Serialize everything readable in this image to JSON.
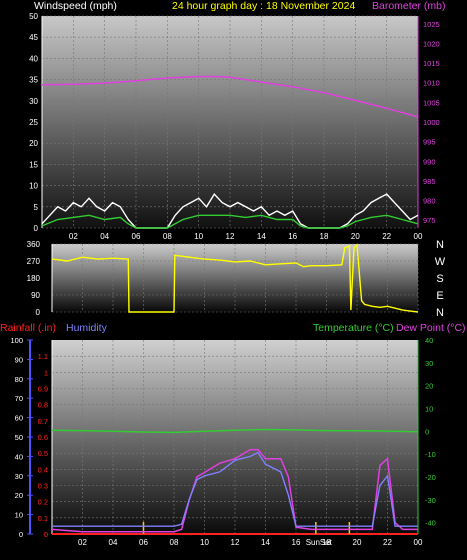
{
  "colors": {
    "background": "#000000",
    "windspeed": "#ffffff",
    "windspeed_avg": "#33cc33",
    "barometer": "#e040e0",
    "wind_dir": "#ffff00",
    "rainfall": "#ff2020",
    "humidity": "#8080ff",
    "temperature": "#33cc33",
    "dew_point": "#e040e0",
    "axis_left": "#5050ff",
    "axis_right_green": "#33cc33",
    "axis_right_barometer": "#e040e0",
    "marker": "#ffcc00"
  },
  "header": {
    "windspeed": "Windspeed (mph)",
    "title": "24 hour graph day : 18 November 2024",
    "barometer": "Barometer (mb)"
  },
  "bottom_header": {
    "rainfall": "Rainfall (.in)",
    "humidity": "Humidity",
    "temperature": "Temperature (°C)",
    "dew_point": "Dew Point (°C)"
  },
  "compass": [
    "N",
    "W",
    "S",
    "E",
    "N"
  ],
  "x_ticks": [
    "02",
    "04",
    "06",
    "08",
    "10",
    "12",
    "14",
    "16",
    "18",
    "20",
    "22",
    "00"
  ],
  "markers": [
    "Sun",
    "Set"
  ],
  "chart_data": [
    {
      "type": "line",
      "title": "24 hour graph day : 18 November 2024",
      "x_unit": "hour",
      "x_range": [
        0,
        24
      ],
      "y_left": {
        "label": "Windspeed (mph)",
        "ticks": [
          0,
          5,
          10,
          15,
          20,
          25,
          30,
          35,
          40,
          45,
          50
        ],
        "ylim": [
          0,
          50
        ]
      },
      "y_right": {
        "label": "Barometer (mb)",
        "ticks": [
          975,
          980,
          985,
          990,
          995,
          1000,
          1005,
          1010,
          1015,
          1020,
          1025
        ],
        "ylim": [
          973,
          1027
        ]
      },
      "series": [
        {
          "name": "Barometer (mb)",
          "axis": "right",
          "x": [
            0,
            2,
            4,
            6,
            8,
            10,
            11,
            12,
            14,
            16,
            18,
            20,
            22,
            24
          ],
          "values": [
            1009.5,
            1009.6,
            1009.9,
            1010.5,
            1011.2,
            1011.6,
            1011.6,
            1011.4,
            1010.2,
            1009.0,
            1007.5,
            1005.5,
            1003.5,
            1001.3
          ]
        },
        {
          "name": "Windspeed (mph)",
          "axis": "left",
          "x": [
            0,
            0.5,
            1,
            1.5,
            2,
            2.5,
            3,
            3.5,
            4,
            4.5,
            5,
            5.5,
            6,
            7,
            8,
            8.5,
            9,
            9.5,
            10,
            10.5,
            11,
            11.5,
            12,
            12.5,
            13,
            13.5,
            14,
            14.5,
            15,
            15.5,
            16,
            16.5,
            17,
            18,
            19,
            19.5,
            20,
            20.5,
            21,
            21.5,
            22,
            22.5,
            23,
            23.5,
            24
          ],
          "values": [
            1,
            3,
            5,
            4,
            6,
            5,
            7,
            5,
            4,
            6,
            5,
            2,
            0,
            0,
            0,
            3,
            5,
            6,
            7,
            5,
            8,
            6,
            5,
            6,
            5,
            4,
            5,
            3,
            4,
            3,
            4,
            1,
            0,
            0,
            0,
            1,
            3,
            4,
            6,
            7,
            8,
            6,
            4,
            2,
            3
          ]
        },
        {
          "name": "Wind average",
          "axis": "left",
          "x": [
            0,
            1,
            2,
            3,
            4,
            5,
            5.5,
            6,
            7,
            8,
            8.5,
            9,
            10,
            11,
            12,
            13,
            14,
            15,
            16,
            16.5,
            17,
            18,
            19,
            19.5,
            20,
            21,
            22,
            23,
            24
          ],
          "values": [
            0.5,
            2,
            2.5,
            3,
            2,
            2.5,
            1,
            0,
            0,
            0,
            1,
            2,
            3,
            3,
            3,
            2.5,
            3,
            2,
            2,
            0.5,
            0,
            0,
            0,
            0.5,
            1.5,
            2.5,
            3,
            2,
            1
          ]
        }
      ]
    },
    {
      "type": "line",
      "title": "",
      "x_unit": "hour",
      "x_range": [
        0,
        24
      ],
      "y_left": {
        "label": "",
        "ticks": [
          0,
          90,
          180,
          270,
          360
        ],
        "ylim": [
          0,
          360
        ]
      },
      "series": [
        {
          "name": "Wind direction",
          "x": [
            0,
            1,
            2,
            3,
            4,
            5,
            5.05,
            8,
            8.05,
            9,
            10,
            11,
            12,
            13,
            14,
            15,
            16,
            16.5,
            17,
            18,
            19,
            19.2,
            19.5,
            19.6,
            19.8,
            20,
            20.3,
            20.5,
            21,
            21.5,
            22,
            22.5,
            23,
            23.5,
            24
          ],
          "values": [
            280,
            270,
            290,
            280,
            285,
            280,
            0,
            0,
            300,
            290,
            280,
            275,
            265,
            270,
            250,
            255,
            260,
            240,
            245,
            245,
            250,
            340,
            350,
            10,
            340,
            355,
            60,
            40,
            30,
            25,
            30,
            20,
            10,
            5,
            0
          ]
        }
      ]
    },
    {
      "type": "line",
      "title": "",
      "x_unit": "hour",
      "x_range": [
        0,
        24
      ],
      "y_left": {
        "label": "Humidity",
        "ticks": [
          0,
          10,
          20,
          30,
          40,
          50,
          60,
          70,
          80,
          90,
          100
        ],
        "ylim": [
          0,
          100
        ]
      },
      "y_left_inner": {
        "label": "Rainfall (.in)",
        "ticks": [
          0,
          0.1,
          0.2,
          0.3,
          0.4,
          0.5,
          0.6,
          0.7,
          0.8,
          0.9,
          1,
          1.1
        ],
        "ylim": [
          0,
          1.2
        ]
      },
      "y_right": {
        "label": "Temperature (°C)",
        "ticks": [
          -40,
          -30,
          -20,
          -10,
          0,
          10,
          20,
          30,
          40
        ],
        "ylim": [
          -45,
          40
        ]
      },
      "series": [
        {
          "name": "Temperature (°C)",
          "axis": "right",
          "x": [
            0,
            2,
            4,
            6,
            8,
            10,
            12,
            14,
            16,
            18,
            20,
            22,
            24
          ],
          "values": [
            0.5,
            0.3,
            0.0,
            -0.3,
            -0.5,
            0.0,
            0.5,
            0.8,
            0.6,
            0.3,
            0.2,
            0.1,
            -0.2
          ]
        },
        {
          "name": "Dew Point (°C)",
          "axis": "right",
          "x": [
            0,
            2,
            4,
            6,
            8,
            8.5,
            9,
            9.5,
            10,
            11,
            12,
            13,
            13.5,
            14,
            15,
            15.5,
            16,
            17,
            18,
            19,
            20,
            21,
            21.5,
            22,
            22.5,
            23,
            24
          ],
          "values": [
            -43,
            -44,
            -44,
            -44,
            -44,
            -43,
            -30,
            -20,
            -18,
            -14,
            -12,
            -8,
            -8,
            -12,
            -12,
            -20,
            -42,
            -43,
            -43,
            -43,
            -43,
            -43,
            -15,
            -12,
            -40,
            -43,
            -43
          ]
        },
        {
          "name": "Humidity",
          "axis": "left",
          "x": [
            0,
            2,
            4,
            6,
            8,
            8.5,
            9,
            9.5,
            10,
            11,
            12,
            13,
            13.5,
            14,
            15,
            15.5,
            16,
            17,
            18,
            19,
            20,
            21,
            21.5,
            22,
            22.5,
            23,
            24
          ],
          "values": [
            4,
            4,
            4,
            4,
            4,
            5,
            18,
            28,
            30,
            32,
            38,
            40,
            42,
            36,
            32,
            20,
            4,
            4,
            4,
            4,
            4,
            4,
            25,
            30,
            4,
            4,
            4
          ]
        },
        {
          "name": "Rainfall (.in)",
          "axis": "inner",
          "x": [
            0,
            24
          ],
          "values": [
            0,
            0
          ]
        }
      ]
    }
  ]
}
